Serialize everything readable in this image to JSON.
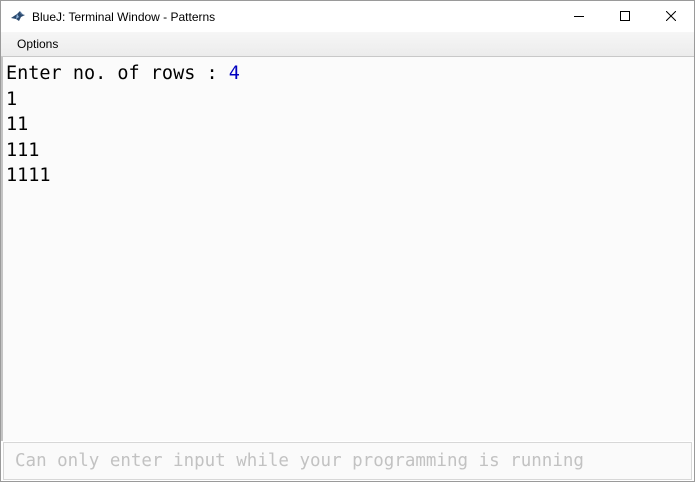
{
  "window": {
    "title": "BlueJ: Terminal Window - Patterns",
    "app_icon": "bluej-bird-icon",
    "controls": {
      "minimize_icon": "minimize-icon",
      "maximize_icon": "maximize-icon",
      "close_icon": "close-icon"
    }
  },
  "menubar": {
    "items": [
      {
        "label": "Options"
      }
    ]
  },
  "terminal": {
    "prompt": "Enter no. of rows : ",
    "input_value": "4",
    "output_lines": [
      "1",
      "11",
      "111",
      "1111"
    ],
    "colors": {
      "output": "#000000",
      "input_echo": "#0000c0"
    }
  },
  "input_bar": {
    "placeholder": "Can only enter input while your programming is running"
  }
}
